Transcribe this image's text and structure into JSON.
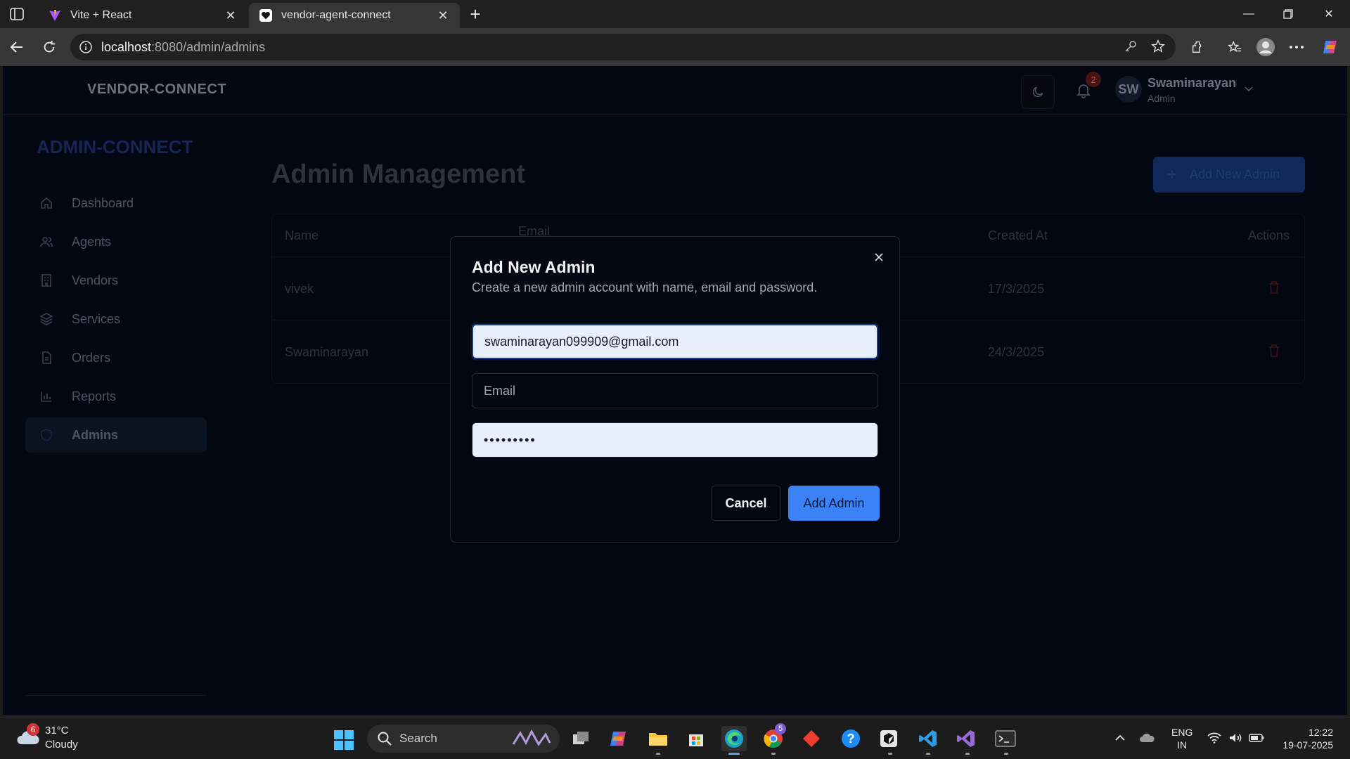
{
  "browser": {
    "tabs": [
      {
        "title": "Vite + React",
        "active": false
      },
      {
        "title": "vendor-agent-connect",
        "active": true
      }
    ],
    "url_host": "localhost",
    "url_path": ":8080/admin/admins"
  },
  "app": {
    "brand": "VENDOR-CONNECT",
    "notification_count": "2",
    "user": {
      "initials": "SW",
      "name": "Swaminarayan",
      "role": "Admin"
    },
    "sidebar": {
      "title": "ADMIN-CONNECT",
      "items": [
        {
          "label": "Dashboard",
          "icon": "home-icon"
        },
        {
          "label": "Agents",
          "icon": "users-icon"
        },
        {
          "label": "Vendors",
          "icon": "building-icon"
        },
        {
          "label": "Services",
          "icon": "layers-icon"
        },
        {
          "label": "Orders",
          "icon": "file-icon"
        },
        {
          "label": "Reports",
          "icon": "bar-chart-icon"
        },
        {
          "label": "Admins",
          "icon": "shield-icon",
          "active": true
        }
      ]
    },
    "page_title": "Admin Management",
    "add_new_button": "Add New Admin",
    "table": {
      "headers": [
        "Name",
        "Email",
        "Created At",
        "Actions"
      ],
      "rows": [
        {
          "name": "vivek",
          "created_at": "17/3/2025"
        },
        {
          "name": "Swaminarayan",
          "created_at": "24/3/2025"
        }
      ]
    }
  },
  "modal": {
    "title": "Add New Admin",
    "description": "Create a new admin account with name, email and password.",
    "name_value": "swaminarayan099909@gmail.com",
    "email_placeholder": "Email",
    "password_value": "•••••••••",
    "cancel_label": "Cancel",
    "submit_label": "Add Admin"
  },
  "taskbar": {
    "weather": {
      "badge": "6",
      "temp": "31°C",
      "condition": "Cloudy"
    },
    "search_label": "Search",
    "language": {
      "line1": "ENG",
      "line2": "IN"
    },
    "time": "12:22",
    "date": "19-07-2025",
    "chrome_badge": "5"
  },
  "colors": {
    "accent": "#3b82f6",
    "background": "#030712"
  }
}
